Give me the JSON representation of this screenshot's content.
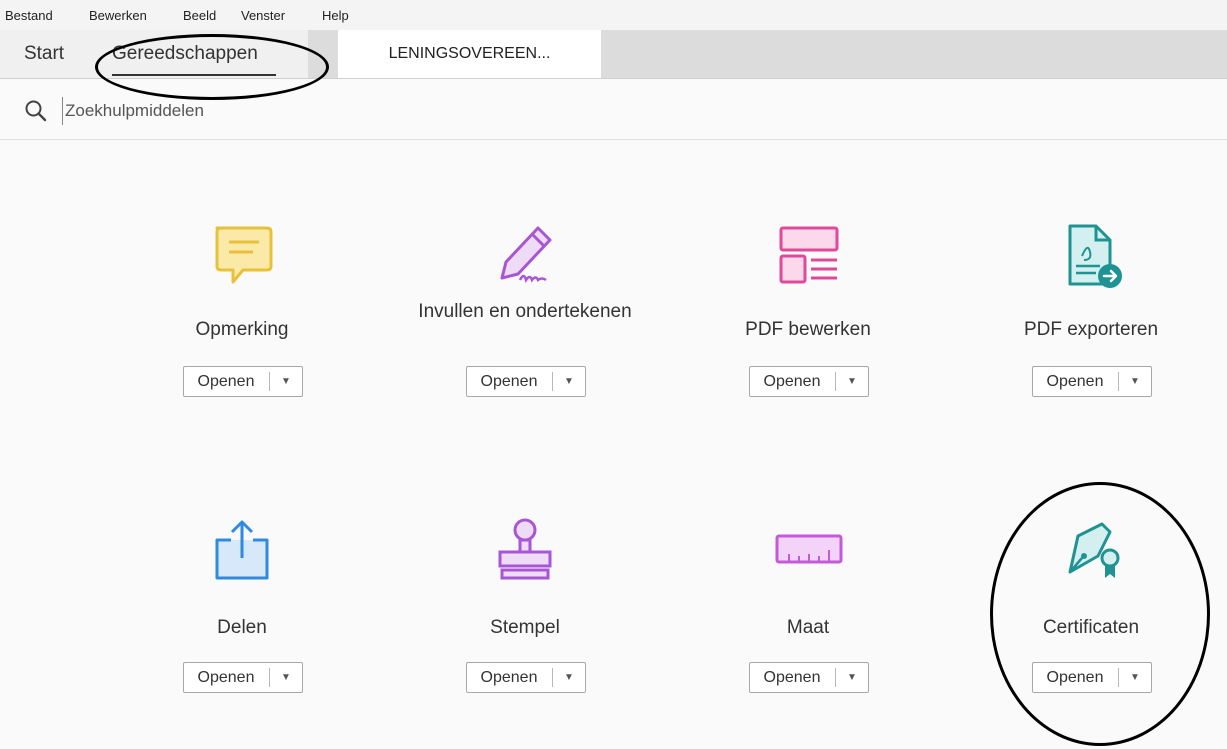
{
  "menu": [
    "Bestand",
    "Bewerken",
    "Beeld",
    "Venster",
    "Help"
  ],
  "tabs": {
    "start": "Start",
    "tools": "Gereedschappen",
    "document": "LENINGSOVEREEN..."
  },
  "search": {
    "placeholder": "Zoekhulpmiddelen"
  },
  "tools": [
    {
      "label": "Opmerking",
      "icon": "comment-icon",
      "color": "#e8c13a",
      "button": "Openen"
    },
    {
      "label": "Invullen en ondertekenen",
      "icon": "fill-sign-icon",
      "color": "#a855d6",
      "button": "Openen"
    },
    {
      "label": "PDF bewerken",
      "icon": "edit-pdf-icon",
      "color": "#e0499b",
      "button": "Openen"
    },
    {
      "label": "PDF exporteren",
      "icon": "export-pdf-icon",
      "color": "#1f9393",
      "button": "Openen"
    },
    {
      "label": "Delen",
      "icon": "share-icon",
      "color": "#2f8ae0",
      "button": "Openen"
    },
    {
      "label": "Stempel",
      "icon": "stamp-icon",
      "color": "#a855d6",
      "button": "Openen"
    },
    {
      "label": "Maat",
      "icon": "measure-icon",
      "color": "#c45ad8",
      "button": "Openen"
    },
    {
      "label": "Certificaten",
      "icon": "certificate-icon",
      "color": "#1f9393",
      "button": "Openen"
    }
  ]
}
